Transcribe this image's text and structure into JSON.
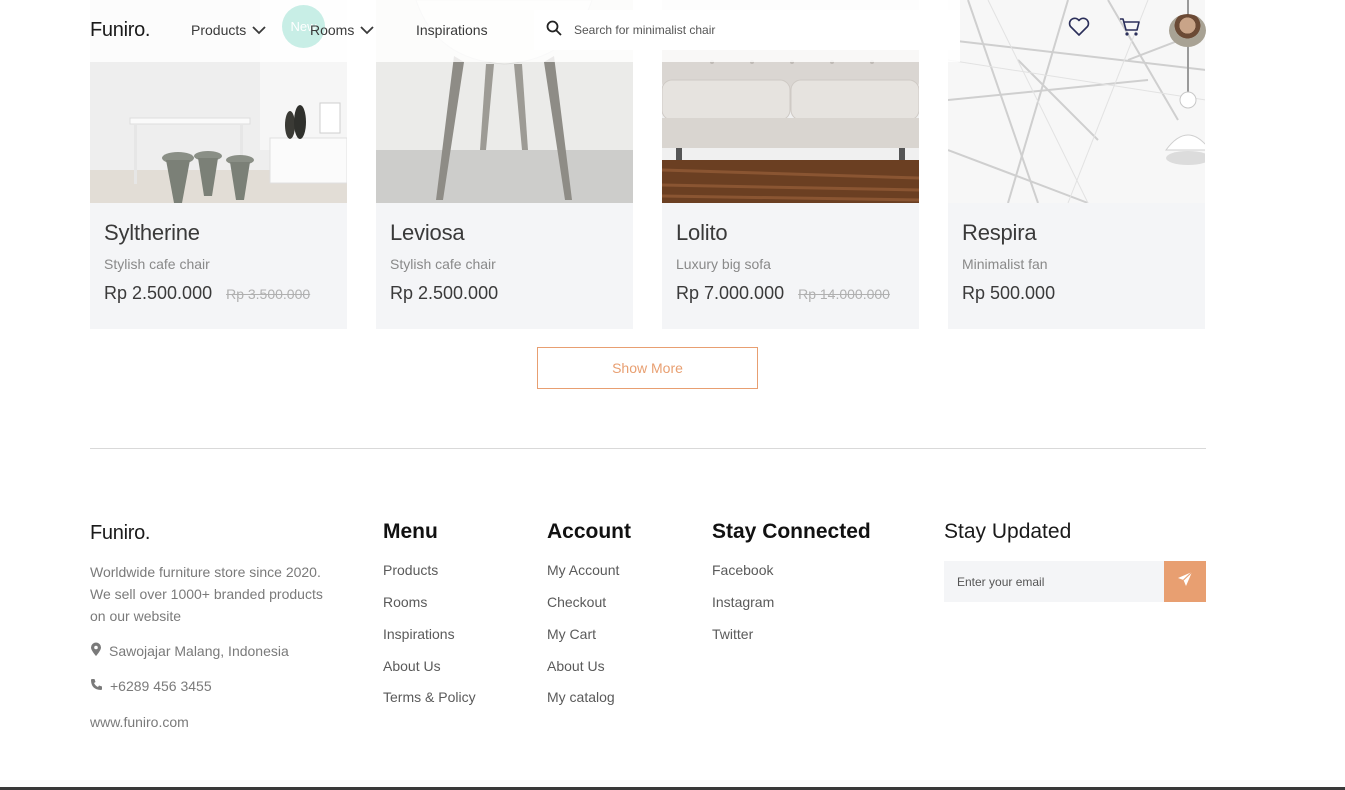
{
  "header": {
    "logo": "Funiro.",
    "nav": {
      "products": "Products",
      "rooms": "Rooms",
      "inspirations": "Inspirations",
      "new_badge": "New"
    },
    "search": {
      "placeholder": "Search for minimalist chair",
      "icon": "search-icon"
    },
    "icons": [
      "heart-icon",
      "cart-icon"
    ],
    "avatar": "user-avatar"
  },
  "products": [
    {
      "name": "Syltherine",
      "description": "Stylish cafe chair",
      "price": "Rp 2.500.000",
      "old_price": "Rp 3.500.000"
    },
    {
      "name": "Leviosa",
      "description": "Stylish cafe chair",
      "price": "Rp 2.500.000",
      "old_price": ""
    },
    {
      "name": "Lolito",
      "description": "Luxury big sofa",
      "price": "Rp 7.000.000",
      "old_price": "Rp 14.000.000"
    },
    {
      "name": "Respira",
      "description": "Minimalist fan",
      "price": "Rp 500.000",
      "old_price": ""
    }
  ],
  "show_more": "Show More",
  "footer": {
    "logo": "Funiro.",
    "about": "Worldwide furniture store since 2020. We sell over 1000+ branded products on our website",
    "address": "Sawojajar Malang, Indonesia",
    "phone": "+6289 456 3455",
    "website": "www.funiro.com",
    "menu": {
      "title": "Menu",
      "links": [
        "Products",
        "Rooms",
        "Inspirations",
        "About Us",
        "Terms & Policy"
      ]
    },
    "account": {
      "title": "Account",
      "links": [
        "My Account",
        "Checkout",
        "My Cart",
        "About Us",
        "My catalog"
      ]
    },
    "connected": {
      "title": "Stay Connected",
      "links": [
        "Facebook",
        "Instagram",
        "Twitter"
      ]
    },
    "updated": {
      "title": "Stay Updated",
      "email_placeholder": "Enter your email"
    }
  },
  "colors": {
    "accent": "#e89f71",
    "card_bg": "#f4f5f7",
    "badge": "#c8eee6"
  }
}
